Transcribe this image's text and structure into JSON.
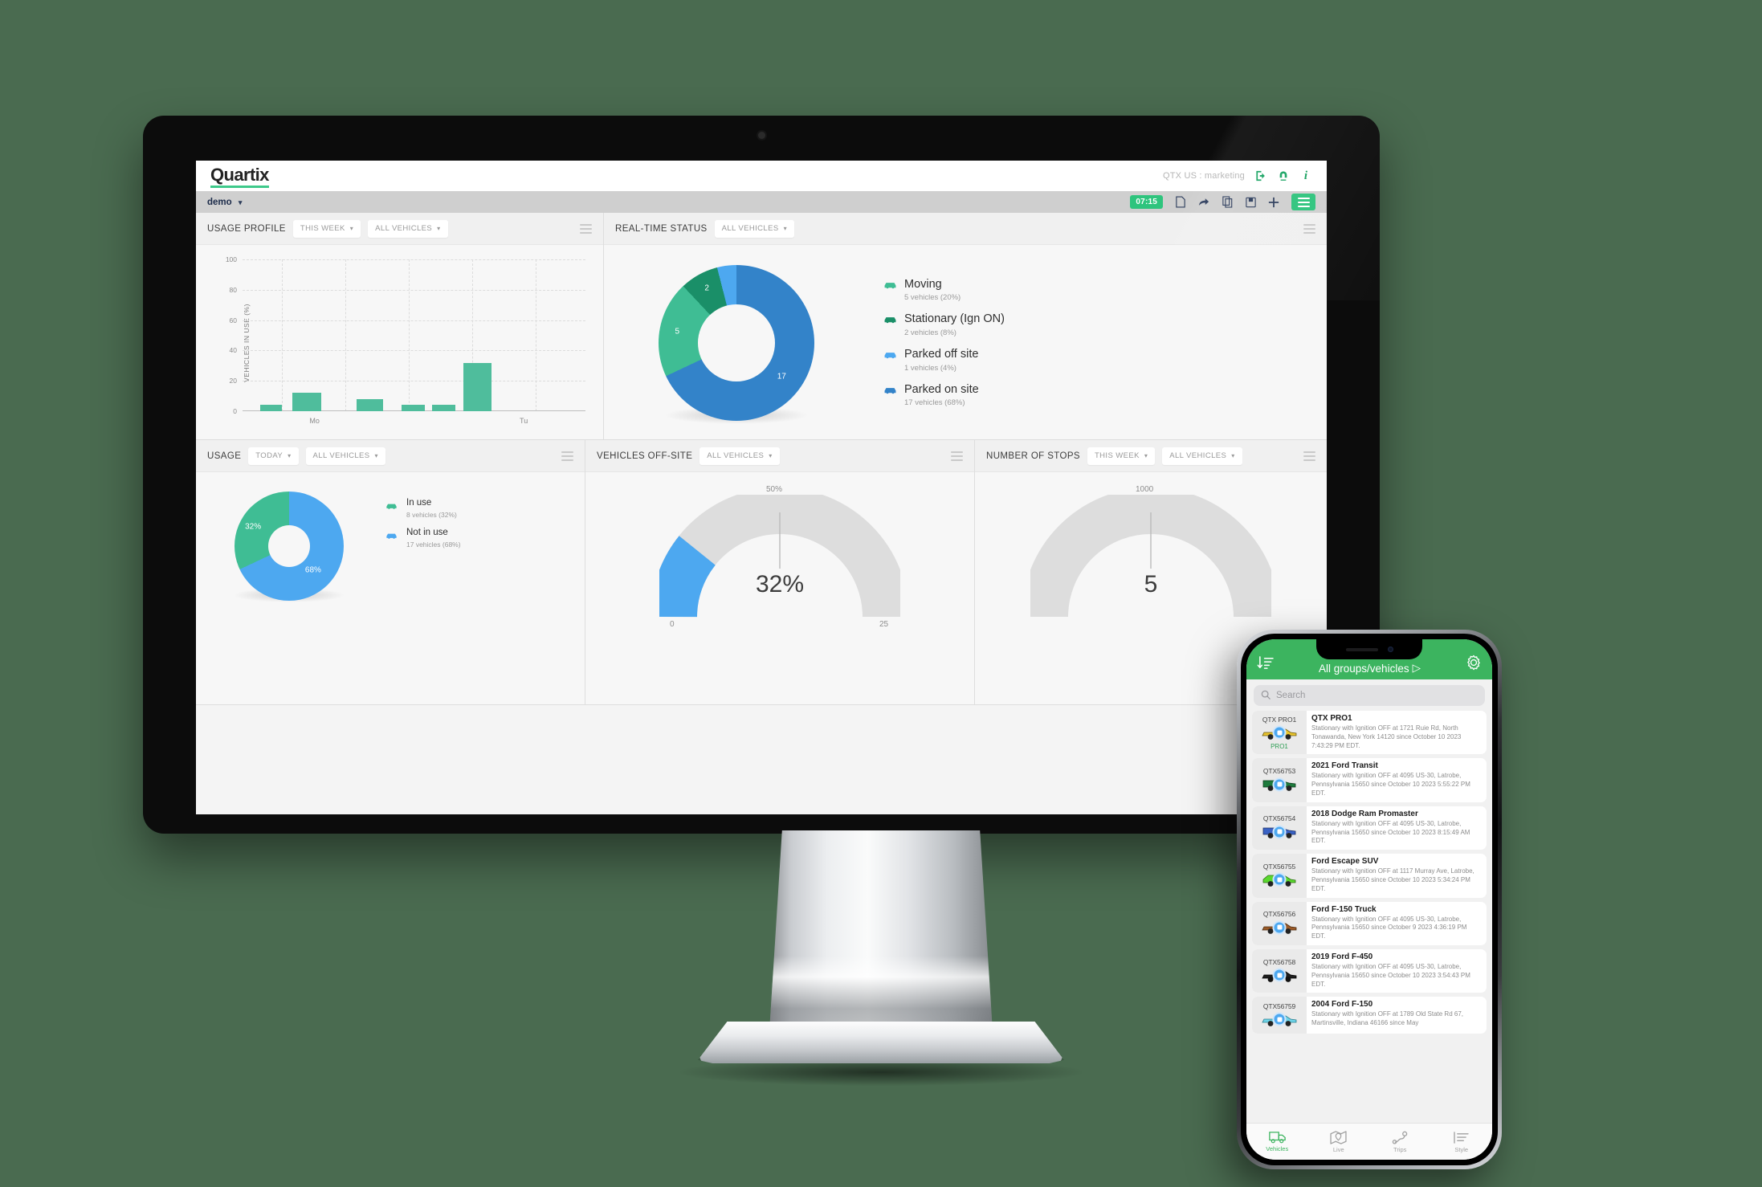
{
  "desktop": {
    "topbar": {
      "brand": "Quartix",
      "account": "QTX US : marketing",
      "icons": [
        "logout-icon",
        "support-icon",
        "info-icon"
      ]
    },
    "subbar": {
      "account_menu": "demo",
      "time_chip": "07:15",
      "icons": [
        "document-icon",
        "share-icon",
        "copy-icon",
        "save-icon",
        "plus-icon",
        "menu-icon"
      ]
    },
    "panels": {
      "usage_profile": {
        "title": "USAGE PROFILE",
        "filters": [
          "THIS WEEK",
          "ALL VEHICLES"
        ]
      },
      "real_time_status": {
        "title": "REAL-TIME STATUS",
        "filters": [
          "ALL VEHICLES"
        ],
        "legend": [
          {
            "label": "Moving",
            "detail": "5 vehicles (20%)",
            "color": "#3fbd94"
          },
          {
            "label": "Stationary (Ign ON)",
            "detail": "2 vehicles (8%)",
            "color": "#1a8f68"
          },
          {
            "label": "Parked off site",
            "detail": "1 vehicles (4%)",
            "color": "#4da8f0"
          },
          {
            "label": "Parked on site",
            "detail": "17 vehicles (68%)",
            "color": "#3383c9"
          }
        ]
      },
      "usage": {
        "title": "USAGE",
        "filters": [
          "TODAY",
          "ALL VEHICLES"
        ],
        "legend": [
          {
            "label": "In use",
            "detail": "8 vehicles (32%)",
            "color": "#3fbd94"
          },
          {
            "label": "Not in use",
            "detail": "17 vehicles (68%)",
            "color": "#4da8f0"
          }
        ],
        "slice_labels": [
          "32%",
          "68%"
        ]
      },
      "vehicles_off_site": {
        "title": "VEHICLES OFF-SITE",
        "filters": [
          "ALL VEHICLES"
        ],
        "value": "32%",
        "tick_min": "0",
        "tick_mid": "50%",
        "tick_max": "25"
      },
      "number_of_stops": {
        "title": "NUMBER OF STOPS",
        "filters": [
          "THIS WEEK",
          "ALL VEHICLES"
        ],
        "value": "5",
        "tick_mid": "1000"
      }
    }
  },
  "chart_data": [
    {
      "type": "bar",
      "title": "USAGE PROFILE",
      "xlabel": "",
      "ylabel": "VEHICLES IN USE (%)",
      "ylim": [
        0,
        100
      ],
      "yticks": [
        0,
        20,
        40,
        60,
        80,
        100
      ],
      "xticks": [
        "Mo",
        "Tu"
      ],
      "grid": true,
      "bar_color": "#4fbd9c",
      "x": [
        1,
        2,
        3,
        4,
        5,
        6
      ],
      "values": [
        4,
        12,
        8,
        4,
        4,
        32
      ]
    },
    {
      "type": "pie",
      "title": "REAL-TIME STATUS",
      "labels": [
        "Parked on site",
        "Moving",
        "Stationary (Ign ON)",
        "Parked off site"
      ],
      "values": [
        17,
        5,
        2,
        1
      ],
      "percents": [
        68,
        20,
        8,
        4
      ],
      "slice_labels": [
        "17",
        "5",
        "2",
        ""
      ],
      "colors": [
        "#3383c9",
        "#3fbd94",
        "#1a8f68",
        "#4da8f0"
      ],
      "legend": "right"
    },
    {
      "type": "pie",
      "title": "USAGE",
      "labels": [
        "Not in use",
        "In use"
      ],
      "values": [
        17,
        8
      ],
      "percents": [
        68,
        32
      ],
      "slice_labels": [
        "68%",
        "32%"
      ],
      "colors": [
        "#4da8f0",
        "#3fbd94"
      ],
      "legend": "right"
    },
    {
      "type": "gauge",
      "title": "VEHICLES OFF-SITE",
      "value": 32,
      "display": "32%",
      "min_label": "0",
      "mid_label": "50%",
      "max_label": "25",
      "fill_fraction": 0.32,
      "color": "#4da8f0",
      "track_color": "#dddddd"
    },
    {
      "type": "gauge",
      "title": "NUMBER OF STOPS",
      "value": 5,
      "display": "5",
      "mid_label": "1000",
      "fill_fraction": 0.0,
      "color": "#4da8f0",
      "track_color": "#dddddd"
    }
  ],
  "mobile": {
    "header": {
      "sort_icon": "sort-icon",
      "title": "All groups/vehicles",
      "title_caret": "▷",
      "settings_icon": "gear-icon"
    },
    "search_placeholder": "Search",
    "vehicles": [
      {
        "reg": "QTX PRO1",
        "tag": "PRO1",
        "name": "QTX PRO1",
        "desc": "Stationary with Ignition OFF at 1721 Ruie Rd, North Tonawanda, New York 14120 since October 10 2023 7:43:29 PM EDT.",
        "color": "#e8c32e",
        "shape": "pickup"
      },
      {
        "reg": "QTX56753",
        "tag": "",
        "name": "2021 Ford Transit",
        "desc": "Stationary with Ignition OFF at 4095 US-30, Latrobe, Pennsylvania 15650 since October 10 2023 5:55:22 PM EDT.",
        "color": "#1e7a3c",
        "shape": "van"
      },
      {
        "reg": "QTX56754",
        "tag": "",
        "name": "2018 Dodge Ram Promaster",
        "desc": "Stationary with Ignition OFF at 4095 US-30, Latrobe, Pennsylvania 15650 since October 10 2023 8:15:49 AM EDT.",
        "color": "#3a62c4",
        "shape": "van"
      },
      {
        "reg": "QTX56755",
        "tag": "",
        "name": "Ford Escape SUV",
        "desc": "Stationary with Ignition OFF at 1117 Murray Ave, Latrobe, Pennsylvania 15650 since October 10 2023 5:34:24 PM EDT.",
        "color": "#5ad82e",
        "shape": "suv"
      },
      {
        "reg": "QTX56756",
        "tag": "",
        "name": "Ford F-150 Truck",
        "desc": "Stationary with Ignition OFF at 4095 US-30, Latrobe, Pennsylvania 15650 since October 9 2023 4:36:19 PM EDT.",
        "color": "#9a5a28",
        "shape": "pickup"
      },
      {
        "reg": "QTX56758",
        "tag": "",
        "name": "2019 Ford F-450",
        "desc": "Stationary with Ignition OFF at 4095 US-30, Latrobe, Pennsylvania 15650 since October 10 2023 3:54:43 PM EDT.",
        "color": "#1d1d1d",
        "shape": "pickup"
      },
      {
        "reg": "QTX56759",
        "tag": "",
        "name": "2004 Ford F-150",
        "desc": "Stationary with Ignition OFF at 1789 Old State Rd 67, Martinsville, Indiana 46166 since May",
        "color": "#6fd4e8",
        "shape": "pickup"
      }
    ],
    "tabs": [
      {
        "label": "Vehicles",
        "icon": "truck-icon",
        "active": true
      },
      {
        "label": "Live",
        "icon": "map-pin-icon",
        "active": false
      },
      {
        "label": "Trips",
        "icon": "route-icon",
        "active": false
      },
      {
        "label": "Style",
        "icon": "list-icon",
        "active": false
      }
    ]
  },
  "theme": {
    "background": "#4a6b50",
    "brand_green": "#3ec98a",
    "mobile_green": "#3cb45f",
    "blue": "#4da8f0",
    "dark_blue": "#3383c9",
    "teal": "#3fbd94",
    "dark_teal": "#1a8f68"
  }
}
